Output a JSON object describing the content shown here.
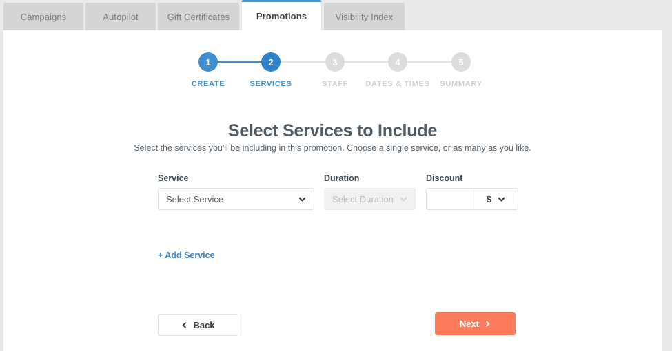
{
  "tabs": [
    {
      "label": "Campaigns",
      "active": false
    },
    {
      "label": "Autopilot",
      "active": false
    },
    {
      "label": "Gift Certificates",
      "active": false
    },
    {
      "label": "Promotions",
      "active": true
    },
    {
      "label": "Visibility Index",
      "active": false
    }
  ],
  "stepper": {
    "steps": [
      {
        "number": "1",
        "label": "CREATE",
        "state": "done"
      },
      {
        "number": "2",
        "label": "SERVICES",
        "state": "active"
      },
      {
        "number": "3",
        "label": "STAFF",
        "state": "todo"
      },
      {
        "number": "4",
        "label": "DATES & TIMES",
        "state": "todo"
      },
      {
        "number": "5",
        "label": "SUMMARY",
        "state": "todo"
      }
    ]
  },
  "heading": {
    "title": "Select Services to Include",
    "subtitle": "Select the services you'll be including in this promotion. Choose a single service, or as many as you like."
  },
  "form": {
    "service": {
      "label": "Service",
      "value": "Select Service",
      "icon": "chevron-down-icon"
    },
    "duration": {
      "label": "Duration",
      "value": "Select Duration",
      "disabled": true,
      "icon": "chevron-down-icon"
    },
    "discount": {
      "label": "Discount",
      "value": "",
      "placeholder": "",
      "unit": "$",
      "unit_options": [
        "$",
        "%"
      ],
      "icon": "chevron-down-icon"
    },
    "add_service_label": "+ Add Service"
  },
  "footer": {
    "back_label": "Back",
    "next_label": "Next"
  },
  "colors": {
    "accent_blue": "#3e8fd0",
    "active_tab_border": "#4a90c4",
    "next_button": "#fb7b5b",
    "step_inactive": "#dcdcdc",
    "page_background": "#e9e9e9"
  }
}
